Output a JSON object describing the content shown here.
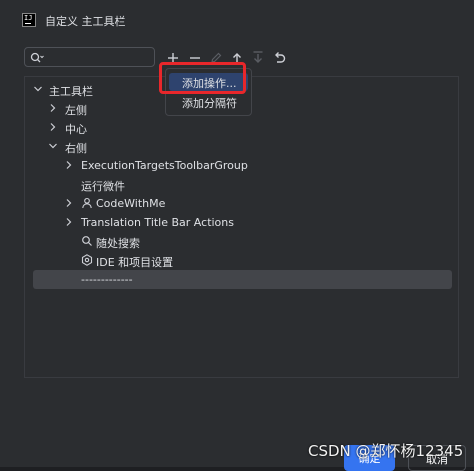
{
  "window": {
    "title": "自定义 主工具栏",
    "app_icon_text": "IJ"
  },
  "search": {
    "value": "",
    "placeholder": ""
  },
  "toolbar": {
    "buttons": [
      {
        "name": "add",
        "icon": "plus-icon",
        "enabled": true
      },
      {
        "name": "remove",
        "icon": "minus-icon",
        "enabled": true
      },
      {
        "name": "edit",
        "icon": "pencil-icon",
        "enabled": false
      },
      {
        "name": "move-up",
        "icon": "arrow-up-icon",
        "enabled": true
      },
      {
        "name": "move-down",
        "icon": "arrow-down-icon",
        "enabled": false
      },
      {
        "name": "restore",
        "icon": "undo-icon",
        "enabled": true
      }
    ]
  },
  "popup": {
    "items": [
      "添加操作...",
      "添加分隔符"
    ],
    "active_index": 0
  },
  "tree": {
    "items": [
      {
        "label": "主工具栏",
        "depth": 0,
        "expander": "expanded"
      },
      {
        "label": "左侧",
        "depth": 1,
        "expander": "collapsed"
      },
      {
        "label": "中心",
        "depth": 1,
        "expander": "collapsed"
      },
      {
        "label": "右侧",
        "depth": 1,
        "expander": "expanded"
      },
      {
        "label": "ExecutionTargetsToolbarGroup",
        "depth": 2,
        "expander": "collapsed"
      },
      {
        "label": "运行微件",
        "depth": 2,
        "expander": "none"
      },
      {
        "label": "CodeWithMe",
        "depth": 2,
        "expander": "collapsed",
        "icon": "user-icon"
      },
      {
        "label": "Translation Title Bar Actions",
        "depth": 2,
        "expander": "collapsed"
      },
      {
        "label": "随处搜索",
        "depth": 2,
        "expander": "none",
        "icon": "search-icon"
      },
      {
        "label": "IDE 和项目设置",
        "depth": 2,
        "expander": "none",
        "icon": "gear-icon"
      },
      {
        "label": "-------------",
        "depth": 2,
        "expander": "none",
        "selected": true
      }
    ]
  },
  "footer": {
    "ok_label": "确定",
    "cancel_label": "取消"
  },
  "watermark": {
    "text": "CSDN @郑怀杨12345"
  },
  "colors": {
    "accent": "#3574f0",
    "highlight": "#e8272b",
    "selection": "#43454a"
  }
}
